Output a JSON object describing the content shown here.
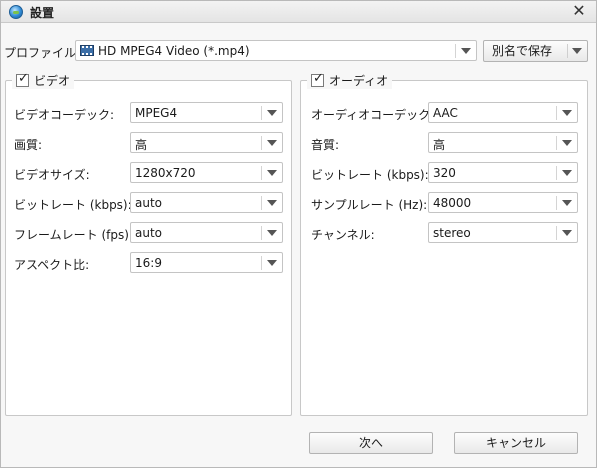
{
  "window": {
    "title": "設置",
    "close_glyph": "✕",
    "icon": "app-globe-icon"
  },
  "profile": {
    "label": "プロファイル:",
    "value": "HD MPEG4 Video (*.mp4)",
    "icon": "film-icon",
    "save_as_label": "別名で保存"
  },
  "video": {
    "legend": "ビデオ",
    "enabled": true,
    "fields": [
      {
        "label": "ビデオコーデック:",
        "value": "MPEG4"
      },
      {
        "label": "画質:",
        "value": "高"
      },
      {
        "label": "ビデオサイズ:",
        "value": "1280x720"
      },
      {
        "label": "ビットレート (kbps):",
        "value": "auto"
      },
      {
        "label": "フレームレート (fps):",
        "value": "auto"
      },
      {
        "label": "アスペクト比:",
        "value": "16:9"
      }
    ]
  },
  "audio": {
    "legend": "オーディオ",
    "enabled": true,
    "fields": [
      {
        "label": "オーディオコーデック:",
        "value": "AAC"
      },
      {
        "label": "音質:",
        "value": "高"
      },
      {
        "label": "ビットレート (kbps):",
        "value": "320"
      },
      {
        "label": "サンプルレート (Hz):",
        "value": "48000"
      },
      {
        "label": "チャンネル:",
        "value": "stereo"
      }
    ]
  },
  "footer": {
    "next_label": "次へ",
    "cancel_label": "キャンセル"
  },
  "colors": {
    "accent": "#2f8bd6",
    "border": "#c4c4c4",
    "background": "#f7f7f7"
  }
}
